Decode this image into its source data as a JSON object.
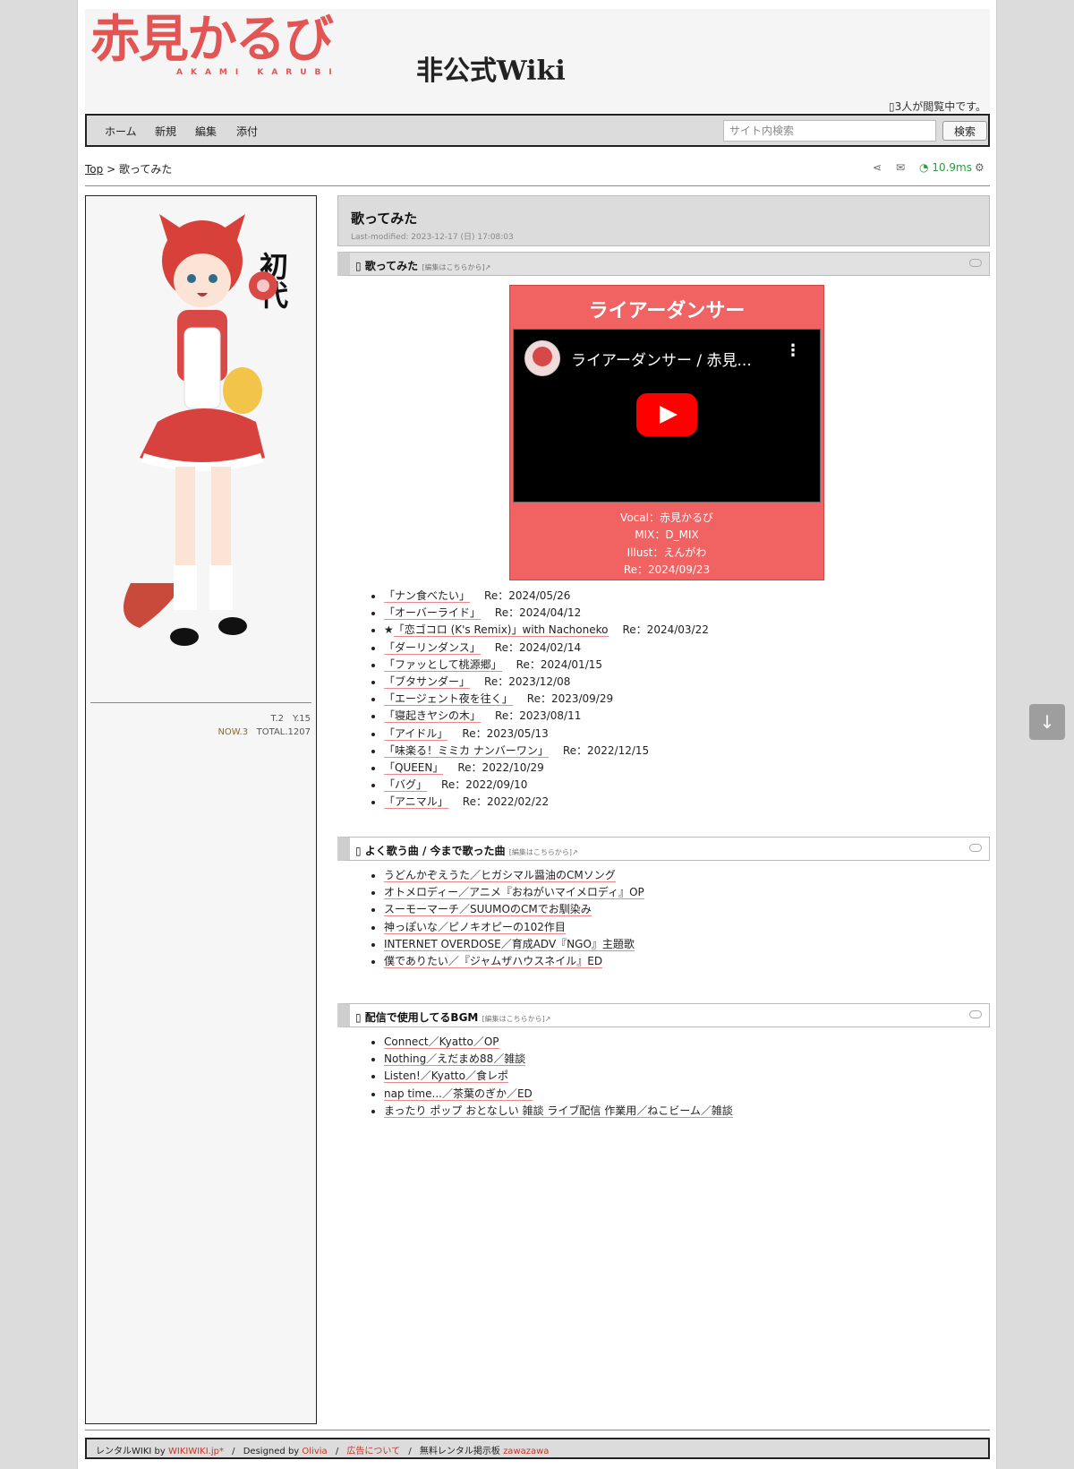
{
  "header": {
    "logo_main": "赤見かるび",
    "logo_sub": "AKAMI KARUBI",
    "logo_wiki": "非公式Wiki",
    "viewers": "3人が閲覧中です。"
  },
  "nav": {
    "items": [
      "ホーム",
      "新規",
      "編集",
      "添付"
    ],
    "search_placeholder": "サイト内検索",
    "search_button": "検索"
  },
  "breadcrumb": {
    "top": "Top",
    "separator": ">",
    "current": "歌ってみた"
  },
  "tools": {
    "timing": "10.9ms"
  },
  "sidebar": {
    "counter_line1": "T.2　Y.15",
    "counter_now": "NOW.3",
    "counter_total": "TOTAL.1207",
    "image_text": "初代"
  },
  "main": {
    "title": "歌ってみた",
    "lastmod": "Last-modified: 2023-12-17 (日) 17:08:03",
    "sections": [
      {
        "heading": "歌ってみた",
        "edit": "[編集はこちらから]↗"
      },
      {
        "heading": "よく歌う曲 / 今まで歌った曲",
        "edit": "[編集はこちらから]↗"
      },
      {
        "heading": "配信で使用してるBGM",
        "edit": "[編集はこちらから]↗"
      }
    ],
    "video": {
      "title": "ライアーダンサー",
      "player_title": "ライアーダンサー / 赤見...",
      "credits": [
        "Vocal：赤見かるび",
        "MIX：D_MIX",
        "Illust：えんがわ",
        "Re：2024/09/23"
      ]
    },
    "covers": [
      {
        "song": "「ナン食べたい」",
        "re": "Re：2024/05/26",
        "star": ""
      },
      {
        "song": "「オーバーライド」",
        "re": "Re：2024/04/12",
        "star": ""
      },
      {
        "song": "「恋ゴコロ (K's Remix)」with Nachoneko",
        "re": "Re：2024/03/22",
        "star": "★"
      },
      {
        "song": "「ダーリンダンス」",
        "re": "Re：2024/02/14",
        "star": ""
      },
      {
        "song": "「ファッとして桃源郷」",
        "re": "Re：2024/01/15",
        "star": ""
      },
      {
        "song": "「ブタサンダー」",
        "re": "Re：2023/12/08",
        "star": ""
      },
      {
        "song": "「エージェント夜を往く」",
        "re": "Re：2023/09/29",
        "star": ""
      },
      {
        "song": "「寝起きヤシの木」",
        "re": "Re：2023/08/11",
        "star": ""
      },
      {
        "song": "「アイドル」",
        "re": "Re：2023/05/13",
        "star": ""
      },
      {
        "song": "「味楽る！ミミカ ナンバーワン」",
        "re": "Re：2022/12/15",
        "star": ""
      },
      {
        "song": "「QUEEN」",
        "re": "Re：2022/10/29",
        "star": ""
      },
      {
        "song": "「バグ」",
        "re": "Re：2022/09/10",
        "star": ""
      },
      {
        "song": "「アニマル」",
        "re": "Re：2022/02/22",
        "star": ""
      }
    ],
    "often_sung": [
      "うどんかぞえうた／ヒガシマル醤油のCMソング",
      "オトメロディー／アニメ『おねがいマイメロディ』OP",
      "スーモーマーチ／SUUMOのCMでお馴染み",
      "神っぽいな／ピノキオピーの102作目",
      "INTERNET OVERDOSE／育成ADV『NGO』主題歌",
      "僕でありたい／『ジャムザハウスネイル』ED"
    ],
    "bgm": [
      "Connect／Kyatto／OP",
      "Nothing／えだまめ88／雑談",
      "Listen!／Kyatto／食レポ",
      "nap time...／茶葉のぎか／ED",
      "まったり ポップ おとなしい 雑談 ライブ配信 作業用／ねこビーム／雑談"
    ]
  },
  "footer": {
    "rental": "レンタルWIKI by",
    "wikiwiki": "WIKIWIKI.jp*",
    "designed": "Designed by",
    "designer": "Olivia",
    "ad": "広告について",
    "board": "無料レンタル掲示板",
    "zawazawa": "zawazawa"
  },
  "colors": {
    "accent": "#e25555",
    "video_bg": "#f06362",
    "link_underline": "#e88888"
  }
}
